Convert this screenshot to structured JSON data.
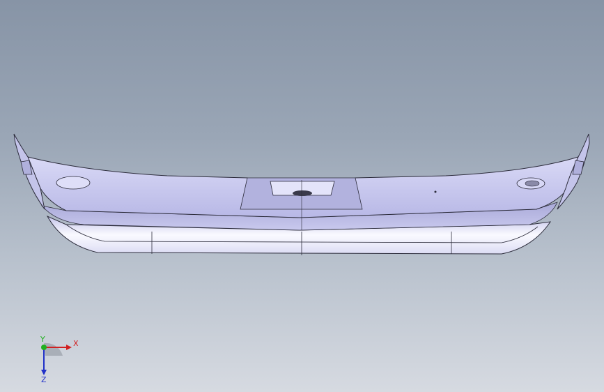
{
  "viewport": {
    "background_top": "#8794a6",
    "background_bottom": "#d6dae1",
    "model_fill": "#c8c8ee",
    "model_fill_light": "#eeeeff",
    "model_edge": "#2b2b3a"
  },
  "triad": {
    "x_label": "X",
    "y_label": "Y",
    "z_label": "Z",
    "x_color": "#d12020",
    "y_color": "#20b020",
    "z_color": "#2030c8"
  }
}
